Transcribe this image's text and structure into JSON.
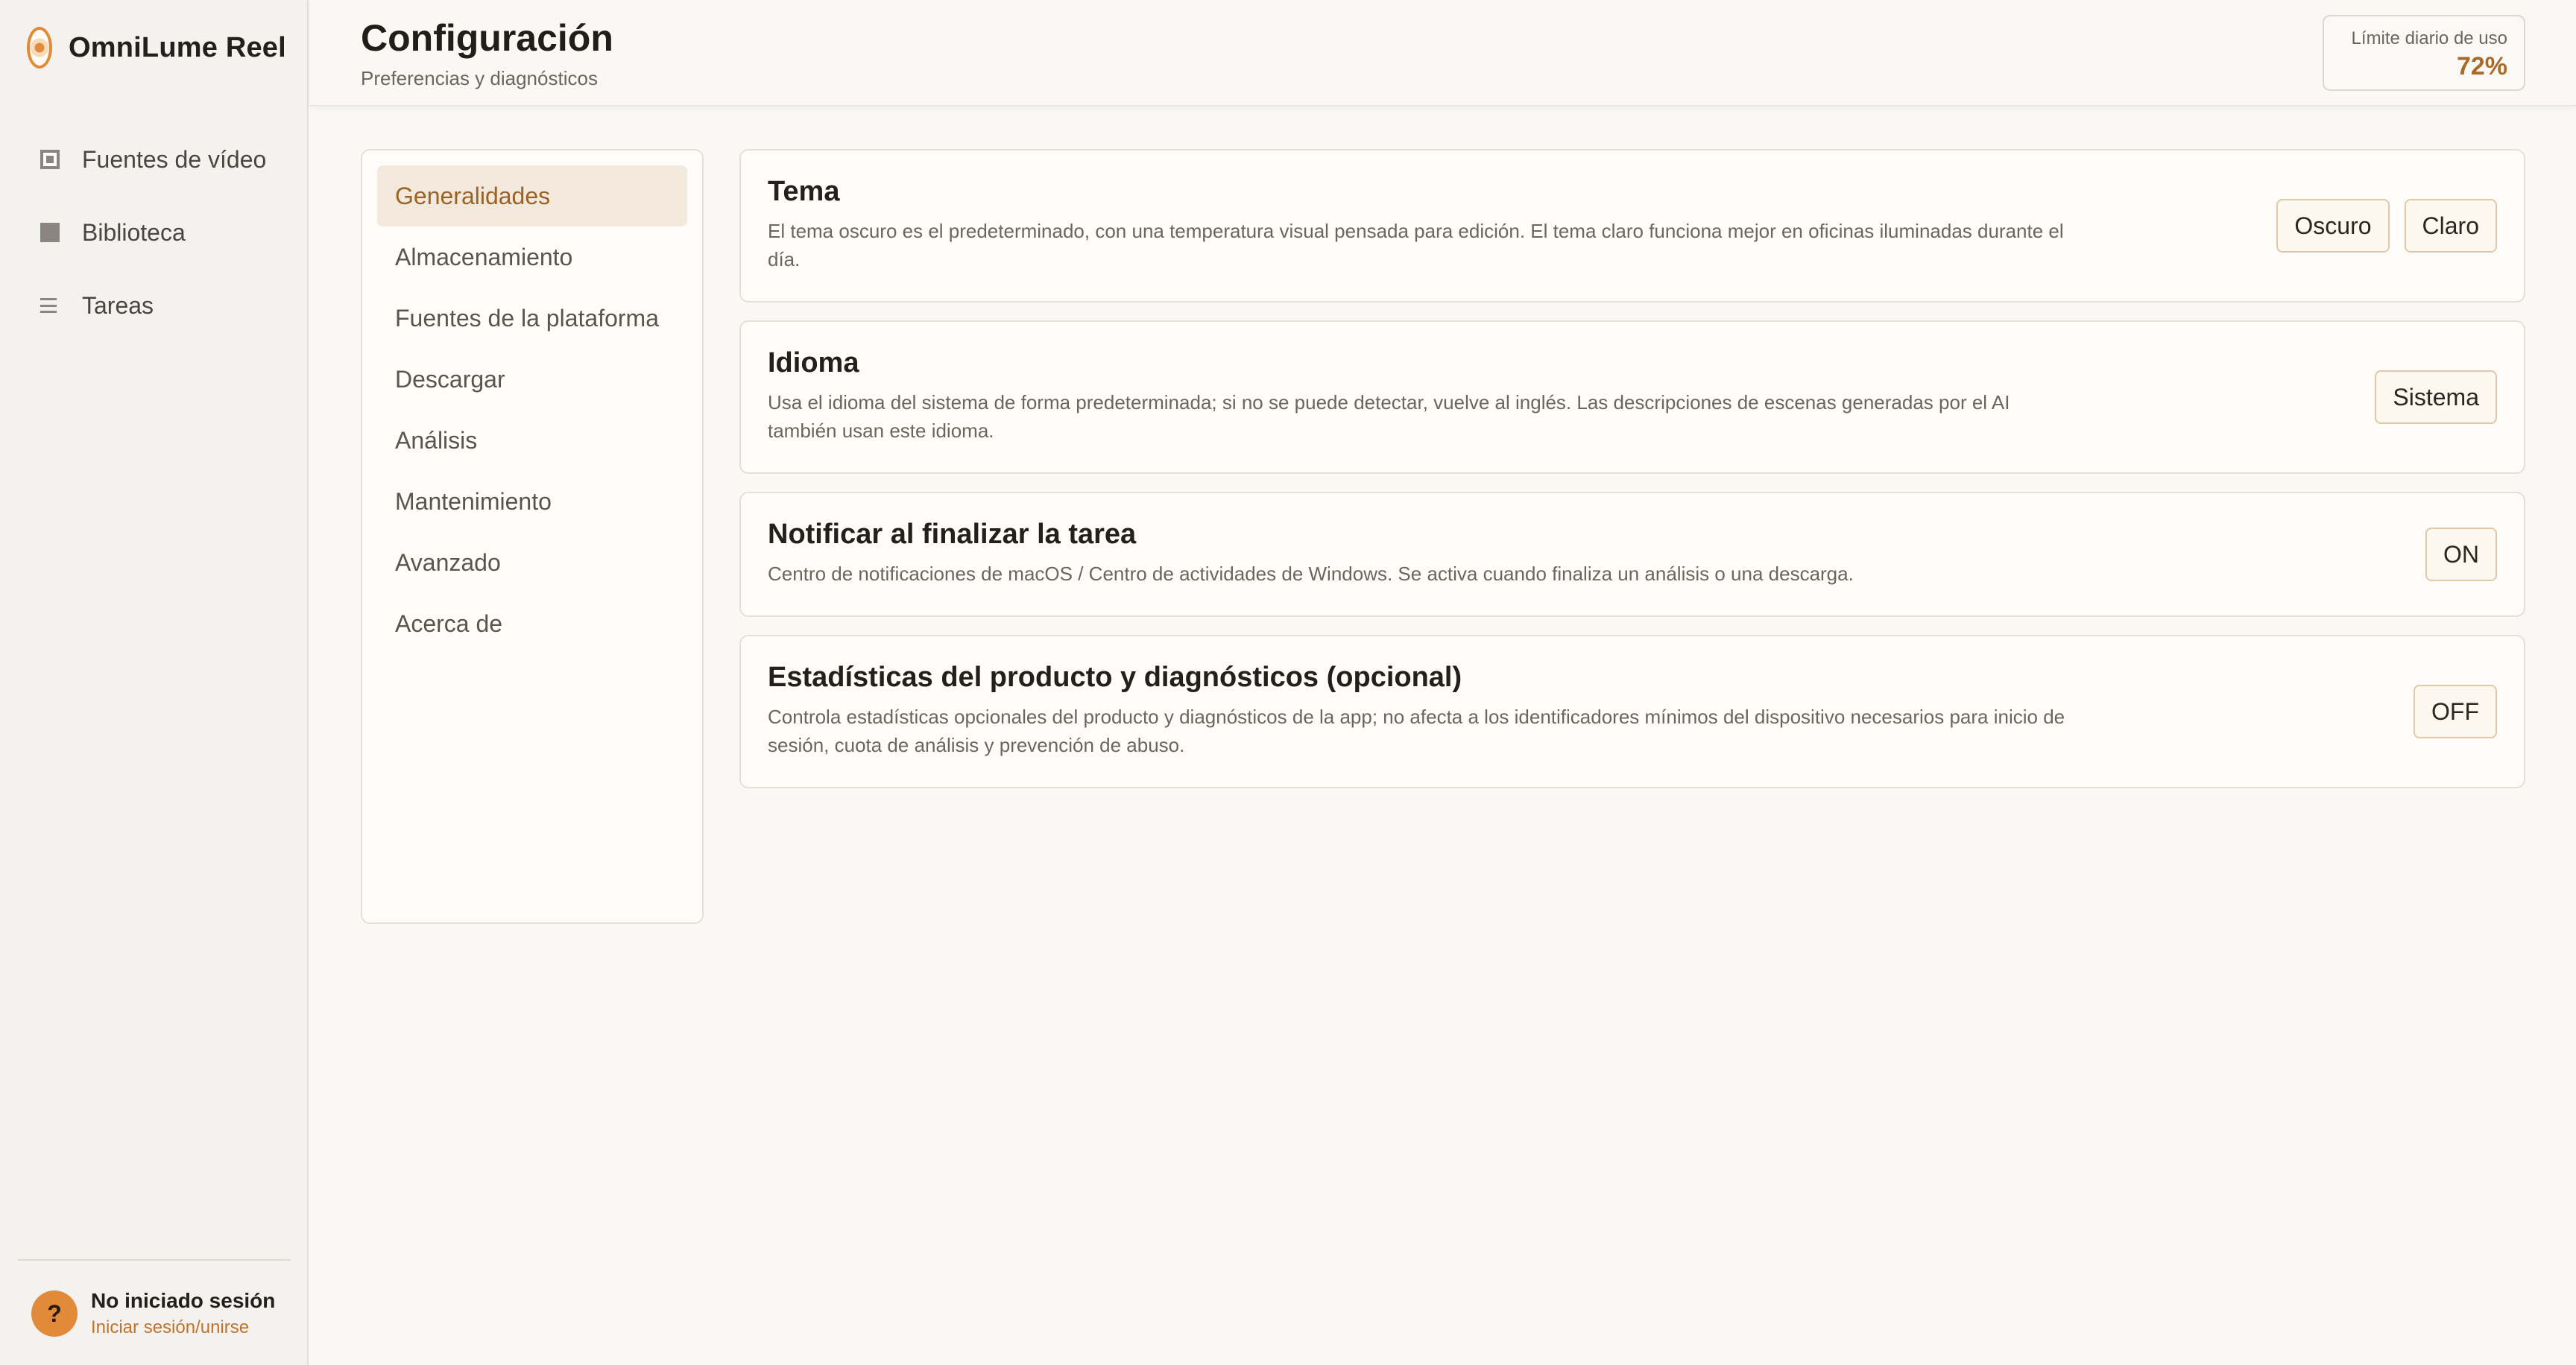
{
  "app": {
    "name": "OmniLume Reel"
  },
  "sidebar": {
    "items": [
      {
        "label": "Fuentes de vídeo",
        "icon": "video-source-icon"
      },
      {
        "label": "Biblioteca",
        "icon": "library-icon"
      },
      {
        "label": "Tareas",
        "icon": "tasks-icon"
      }
    ],
    "user": {
      "avatar_glyph": "?",
      "status": "No iniciado sesión",
      "link": "Iniciar sesión/unirse"
    }
  },
  "header": {
    "title": "Configuración",
    "subtitle": "Preferencias y diagnósticos",
    "quota": {
      "label": "Límite diario de uso",
      "value": "72%"
    }
  },
  "settings_menu": {
    "items": [
      "Generalidades",
      "Almacenamiento",
      "Fuentes de la plataforma",
      "Descargar",
      "Análisis",
      "Mantenimiento",
      "Avanzado",
      "Acerca de"
    ],
    "active": "Generalidades"
  },
  "cards": {
    "theme": {
      "title": "Tema",
      "desc": "El tema oscuro es el predeterminado, con una temperatura visual pensada para edición. El tema claro funciona mejor en oficinas iluminadas durante el día.",
      "options": [
        "Oscuro",
        "Claro"
      ]
    },
    "language": {
      "title": "Idioma",
      "desc": "Usa el idioma del sistema de forma predeterminada; si no se puede detectar, vuelve al inglés. Las descripciones de escenas generadas por el AI también usan este idioma.",
      "value": "Sistema"
    },
    "notify": {
      "title": "Notificar al finalizar la tarea",
      "desc": "Centro de notificaciones de macOS / Centro de actividades de Windows. Se activa cuando finaliza un análisis o una descarga.",
      "value": "ON"
    },
    "stats": {
      "title": "Estadísticas del producto y diagnósticos (opcional)",
      "desc": "Controla estadísticas opcionales del producto y diagnósticos de la app; no afecta a los identificadores mínimos del dispositivo necesarios para inicio de sesión, cuota de análisis y prevención de abuso.",
      "value": "OFF"
    }
  },
  "colors": {
    "accent": "#e08a3a",
    "accent_text": "#a86a24",
    "active_bg": "#f3e8dc",
    "sidebar_bg": "#f3f2ee",
    "page_bg": "#f9f8f5"
  }
}
